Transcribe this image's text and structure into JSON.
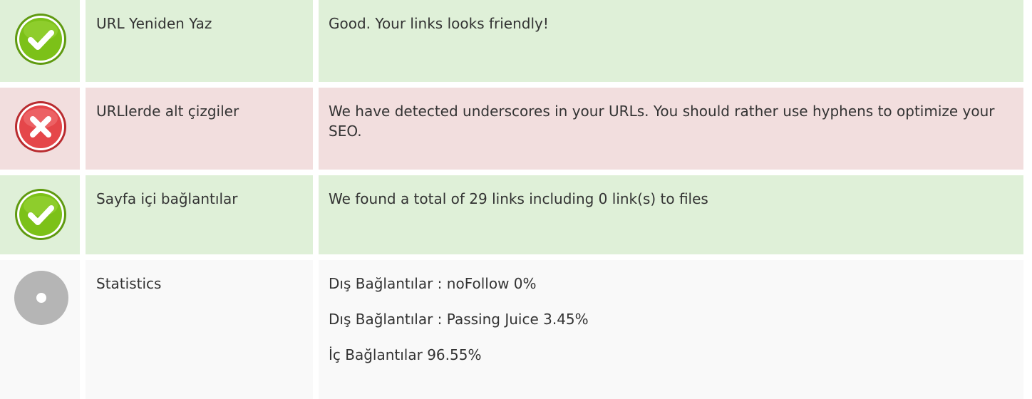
{
  "rows": [
    {
      "status": "ok",
      "icon": "check-icon",
      "name": "URL Yeniden Yaz",
      "description": "Good. Your links looks friendly!"
    },
    {
      "status": "bad",
      "icon": "error-x-icon",
      "name": "URLlerde alt çizgiler",
      "description": "We have detected underscores in your URLs. You should rather use hyphens to optimize your SEO."
    },
    {
      "status": "ok",
      "icon": "check-icon",
      "name": "Sayfa içi bağlantılar",
      "description": "We found a total of 29 links including 0 link(s) to files"
    },
    {
      "status": "neutral",
      "icon": "neutral-dot-icon",
      "name": "Statistics",
      "stats": [
        "Dış Bağlantılar : noFollow 0%",
        "Dış Bağlantılar : Passing Juice 3.45%",
        "İç Bağlantılar 96.55%"
      ]
    }
  ],
  "colors": {
    "ok_bg": "#dff0d8",
    "bad_bg": "#f2dede",
    "neutral_bg": "#f9f9f9",
    "check_green": "#7cc118",
    "error_red": "#e5464a",
    "neutral_gray": "#b5b5b5"
  }
}
